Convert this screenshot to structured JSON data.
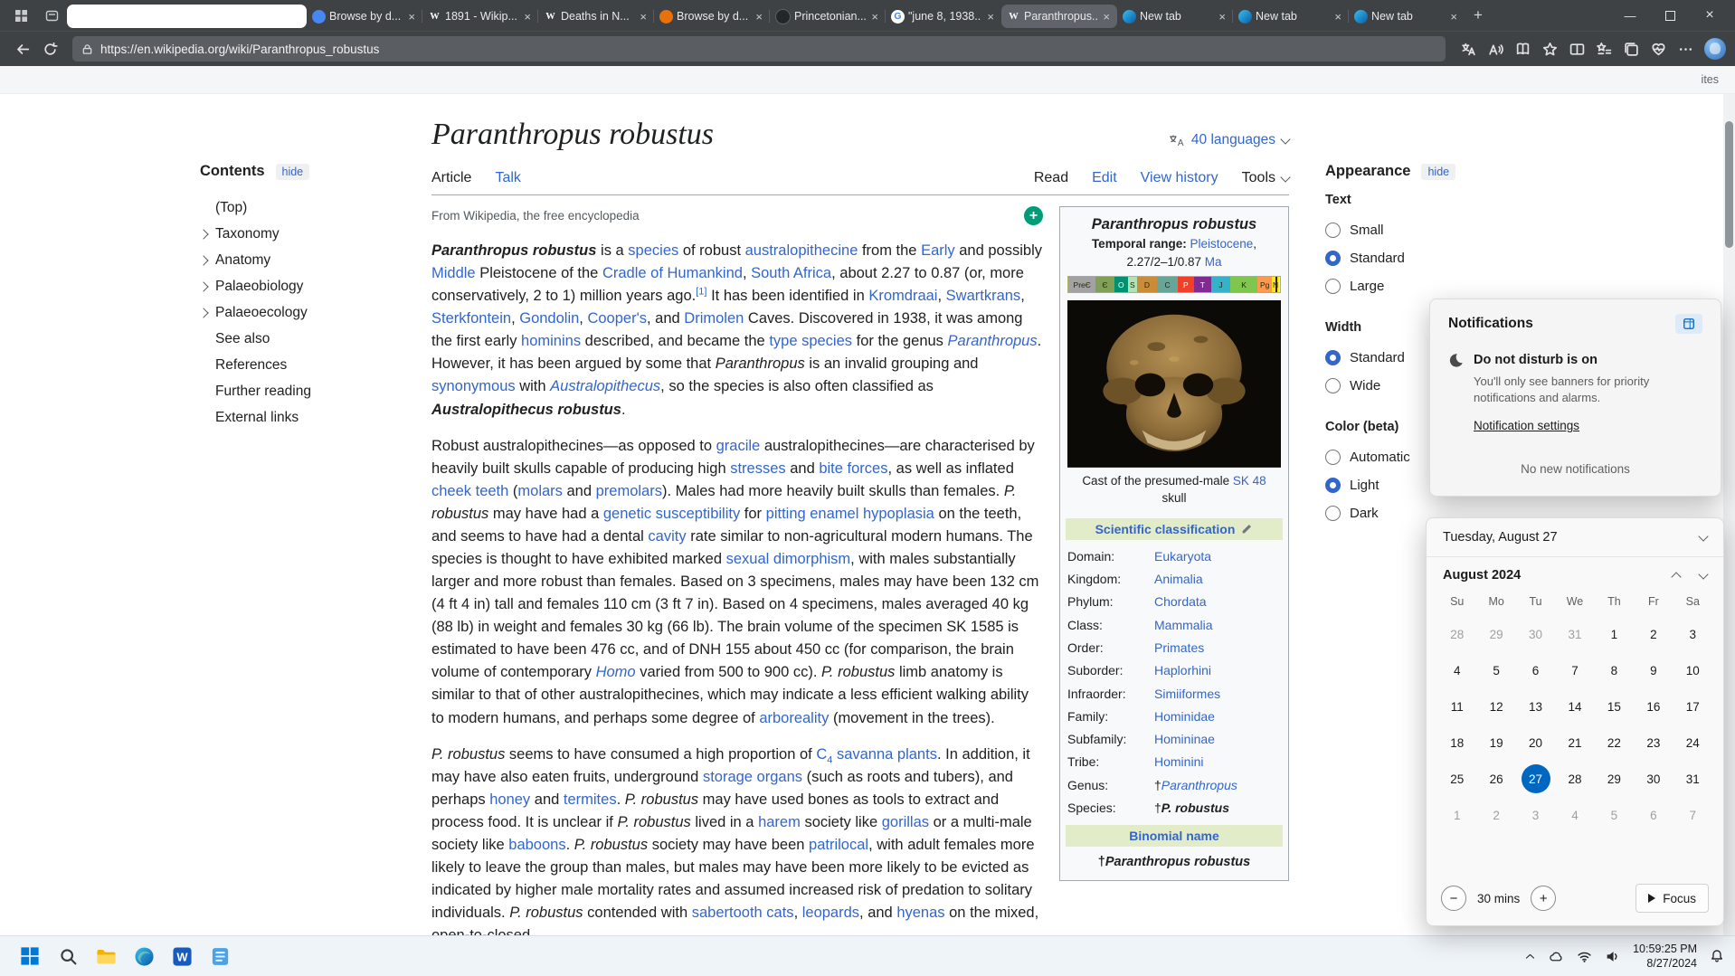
{
  "colors": {
    "accent": "#0067c0",
    "wikilink": "#3366cc",
    "taxobox": "#e3ecc8",
    "accent-wiki": "#3366cc"
  },
  "browser": {
    "tabs": [
      {
        "blank": true
      },
      {
        "label": "Browse by d...",
        "favicon": "globe-blue"
      },
      {
        "label": "1891 - Wikip...",
        "favicon": "wikipedia"
      },
      {
        "label": "Deaths in N...",
        "favicon": "wikipedia"
      },
      {
        "label": "Browse by d...",
        "favicon": "globe-orange"
      },
      {
        "label": "Princetonian...",
        "favicon": "dark"
      },
      {
        "label": "\"june 8, 1938...",
        "favicon": "google"
      },
      {
        "label": "Paranthropus...",
        "favicon": "wikipedia",
        "active": true
      },
      {
        "label": "New tab",
        "favicon": "edge"
      },
      {
        "label": "New tab",
        "favicon": "edge"
      },
      {
        "label": "New tab",
        "favicon": "edge"
      }
    ],
    "url": "https://en.wikipedia.org/wiki/Paranthropus_robustus",
    "favbar_right": "ites"
  },
  "wiki": {
    "title": "Paranthropus robustus",
    "languages": "40 languages",
    "subtitle": "From Wikipedia, the free encyclopedia",
    "page_tabs": [
      {
        "label": "Article",
        "dark": true
      },
      {
        "label": "Talk"
      }
    ],
    "view_tabs": [
      {
        "label": "Read",
        "dark": true
      },
      {
        "label": "Edit"
      },
      {
        "label": "View history"
      },
      {
        "label": "Tools",
        "dark": true,
        "chev": true
      }
    ],
    "toc": {
      "title": "Contents",
      "hide": "hide",
      "items": [
        {
          "label": "(Top)",
          "chev": false
        },
        {
          "label": "Taxonomy",
          "chev": true
        },
        {
          "label": "Anatomy",
          "chev": true
        },
        {
          "label": "Palaeobiology",
          "chev": true
        },
        {
          "label": "Palaeoecology",
          "chev": true
        },
        {
          "label": "See also",
          "chev": false
        },
        {
          "label": "References",
          "chev": false
        },
        {
          "label": "Further reading",
          "chev": false
        },
        {
          "label": "External links",
          "chev": false
        }
      ]
    },
    "paragraphs": [
      [
        {
          "t": "Paranthropus robustus",
          "b": 1,
          "i": 1
        },
        {
          "t": " is a "
        },
        {
          "t": "species",
          "link": 1
        },
        {
          "t": " of robust "
        },
        {
          "t": "australopithecine",
          "link": 1
        },
        {
          "t": " from the "
        },
        {
          "t": "Early",
          "link": 1
        },
        {
          "t": " and possibly "
        },
        {
          "t": "Middle",
          "link": 1
        },
        {
          "t": " Pleistocene of the "
        },
        {
          "t": "Cradle of Humankind",
          "link": 1
        },
        {
          "t": ", "
        },
        {
          "t": "South Africa",
          "link": 1
        },
        {
          "t": ", about 2.27 to 0.87 (or, more conservatively, 2 to 1) million years ago."
        },
        {
          "t": "[1]",
          "link": 1,
          "sup": 1
        },
        {
          "t": " It has been identified in "
        },
        {
          "t": "Kromdraai",
          "link": 1
        },
        {
          "t": ", "
        },
        {
          "t": "Swartkrans",
          "link": 1
        },
        {
          "t": ", "
        },
        {
          "t": "Sterkfontein",
          "link": 1
        },
        {
          "t": ", "
        },
        {
          "t": "Gondolin",
          "link": 1
        },
        {
          "t": ", "
        },
        {
          "t": "Cooper's",
          "link": 1
        },
        {
          "t": ", and "
        },
        {
          "t": "Drimolen",
          "link": 1
        },
        {
          "t": " Caves. Discovered in 1938, it was among the first early "
        },
        {
          "t": "hominins",
          "link": 1
        },
        {
          "t": " described, and became the "
        },
        {
          "t": "type species",
          "link": 1
        },
        {
          "t": " for the genus "
        },
        {
          "t": "Paranthropus",
          "link": 1,
          "i": 1
        },
        {
          "t": ". However, it has been argued by some that "
        },
        {
          "t": "Paranthropus",
          "i": 1
        },
        {
          "t": " is an invalid grouping and "
        },
        {
          "t": "synonymous",
          "link": 1
        },
        {
          "t": " with "
        },
        {
          "t": "Australopithecus",
          "link": 1,
          "i": 1
        },
        {
          "t": ", so the species is also often classified as "
        },
        {
          "t": "Australopithecus robustus",
          "b": 1,
          "i": 1
        },
        {
          "t": "."
        }
      ],
      [
        {
          "t": "Robust australopithecines—as opposed to "
        },
        {
          "t": "gracile",
          "link": 1
        },
        {
          "t": " australopithecines—are characterised by heavily built skulls capable of producing high "
        },
        {
          "t": "stresses",
          "link": 1
        },
        {
          "t": " and "
        },
        {
          "t": "bite forces",
          "link": 1
        },
        {
          "t": ", as well as inflated "
        },
        {
          "t": "cheek teeth",
          "link": 1
        },
        {
          "t": " ("
        },
        {
          "t": "molars",
          "link": 1
        },
        {
          "t": " and "
        },
        {
          "t": "premolars",
          "link": 1
        },
        {
          "t": "). Males had more heavily built skulls than females. "
        },
        {
          "t": "P. robustus",
          "i": 1
        },
        {
          "t": " may have had a "
        },
        {
          "t": "genetic susceptibility",
          "link": 1
        },
        {
          "t": " for "
        },
        {
          "t": "pitting enamel hypoplasia",
          "link": 1
        },
        {
          "t": " on the teeth, and seems to have had a dental "
        },
        {
          "t": "cavity",
          "link": 1
        },
        {
          "t": " rate similar to non-agricultural modern humans. The species is thought to have exhibited marked "
        },
        {
          "t": "sexual dimorphism",
          "link": 1
        },
        {
          "t": ", with males substantially larger and more robust than females. Based on 3 specimens, males may have been 132 cm (4 ft 4 in) tall and females 110 cm (3 ft 7 in). Based on 4 specimens, males averaged 40 kg (88 lb) in weight and females 30 kg (66 lb). The brain volume of the specimen SK 1585 is estimated to have been 476 cc, and of DNH 155 about 450 cc (for comparison, the brain volume of contemporary "
        },
        {
          "t": "Homo",
          "link": 1,
          "i": 1
        },
        {
          "t": " varied from 500 to 900 cc). "
        },
        {
          "t": "P. robustus",
          "i": 1
        },
        {
          "t": " limb anatomy is similar to that of other australopithecines, which may indicate a less efficient walking ability to modern humans, and perhaps some degree of "
        },
        {
          "t": "arboreality",
          "link": 1
        },
        {
          "t": " (movement in the trees)."
        }
      ],
      [
        {
          "t": "P. robustus",
          "i": 1
        },
        {
          "t": " seems to have consumed a high proportion of "
        },
        {
          "t": "C",
          "link": 1
        },
        {
          "t": "4",
          "link": 1,
          "sub": 1
        },
        {
          "t": " savanna plants",
          "link": 1
        },
        {
          "t": ". In addition, it may have also eaten fruits, underground "
        },
        {
          "t": "storage organs",
          "link": 1
        },
        {
          "t": " (such as roots and tubers), and perhaps "
        },
        {
          "t": "honey",
          "link": 1
        },
        {
          "t": " and "
        },
        {
          "t": "termites",
          "link": 1
        },
        {
          "t": ". "
        },
        {
          "t": "P. robustus",
          "i": 1
        },
        {
          "t": " may have used bones as tools to extract and process food. It is unclear if "
        },
        {
          "t": "P. robustus",
          "i": 1
        },
        {
          "t": " lived in a "
        },
        {
          "t": "harem",
          "link": 1
        },
        {
          "t": " society like "
        },
        {
          "t": "gorillas",
          "link": 1
        },
        {
          "t": " or a multi-male society like "
        },
        {
          "t": "baboons",
          "link": 1
        },
        {
          "t": ". "
        },
        {
          "t": "P. robustus",
          "i": 1
        },
        {
          "t": " society may have been "
        },
        {
          "t": "patrilocal",
          "link": 1
        },
        {
          "t": ", with adult females more likely to leave the group than males, but males may have been more likely to be evicted as indicated by higher male mortality rates and assumed increased risk of predation to solitary individuals. "
        },
        {
          "t": "P. robustus",
          "i": 1
        },
        {
          "t": " contended with "
        },
        {
          "t": "sabertooth cats",
          "link": 1
        },
        {
          "t": ", "
        },
        {
          "t": "leopards",
          "link": 1
        },
        {
          "t": ", and "
        },
        {
          "t": "hyenas",
          "link": 1
        },
        {
          "t": "​ on the mixed, open-to-closed "
        }
      ]
    ],
    "infobox": {
      "title": "Paranthropus robustus",
      "temporal_label": "Temporal range:",
      "temporal_link": "Pleistocene",
      "temporal_range": "2.27/2–1/0.87",
      "temporal_unit": "Ma",
      "timeline": [
        {
          "label": "PreЄ",
          "color": "#a2a2a2",
          "w": 13
        },
        {
          "label": "Є",
          "color": "#7FA056",
          "w": 8.6
        },
        {
          "label": "O",
          "color": "#009270",
          "w": 6.7,
          "lt": 1
        },
        {
          "label": "S",
          "color": "#B3E1B6",
          "w": 4
        },
        {
          "label": "D",
          "color": "#CB8C37",
          "w": 9.7
        },
        {
          "label": "C",
          "color": "#67A599",
          "w": 9.7
        },
        {
          "label": "P",
          "color": "#F04028",
          "w": 7.6,
          "lt": 1
        },
        {
          "label": "T",
          "color": "#812B92",
          "w": 8.2,
          "lt": 1
        },
        {
          "label": "J",
          "color": "#34B2C9",
          "w": 9.1
        },
        {
          "label": "K",
          "color": "#7FC64E",
          "w": 12.8
        },
        {
          "label": "Pg",
          "color": "#FD9A52",
          "w": 6.9
        },
        {
          "label": "N",
          "color": "#FFE619",
          "w": 3.3
        },
        {
          "label": "",
          "color": "#F9F97F",
          "w": 0.4
        }
      ],
      "caption_pre": "Cast of the presumed-male ",
      "caption_link": "SK 48",
      "caption_post": " skull",
      "classification_header": "Scientific classification",
      "rows": [
        {
          "label": "Domain:",
          "value": "Eukaryota"
        },
        {
          "label": "Kingdom:",
          "value": "Animalia"
        },
        {
          "label": "Phylum:",
          "value": "Chordata"
        },
        {
          "label": "Class:",
          "value": "Mammalia"
        },
        {
          "label": "Order:",
          "value": "Primates"
        },
        {
          "label": "Suborder:",
          "value": "Haplorhini"
        },
        {
          "label": "Infraorder:",
          "value": "Simiiformes"
        },
        {
          "label": "Family:",
          "value": "Hominidae"
        },
        {
          "label": "Subfamily:",
          "value": "Homininae"
        },
        {
          "label": "Tribe:",
          "value": "Hominini"
        },
        {
          "label": "Genus:",
          "value": "Paranthropus",
          "dagger": true,
          "italic": true
        },
        {
          "label": "Species:",
          "value": "P. robustus",
          "dagger": true,
          "italic": true,
          "bold": true,
          "plain": true
        }
      ],
      "binomial_header": "Binomial name",
      "binomial_dagger": "†",
      "binomial": "Paranthropus robustus"
    },
    "appearance": {
      "title": "Appearance",
      "hide": "hide",
      "sections": [
        {
          "label": "Text",
          "options": [
            "Small",
            "Standard",
            "Large"
          ],
          "selected": 1
        },
        {
          "label": "Width",
          "options": [
            "Standard",
            "Wide"
          ],
          "selected": 0
        },
        {
          "label": "Color (beta)",
          "options": [
            "Automatic",
            "Light",
            "Dark"
          ],
          "selected": 1
        }
      ]
    }
  },
  "notifications": {
    "title": "Notifications",
    "dnd_title": "Do not disturb is on",
    "dnd_desc": "You'll only see banners for priority notifications and alarms.",
    "settings_link": "Notification settings",
    "empty": "No new notifications"
  },
  "calendar": {
    "header": "Tuesday, August 27",
    "month": "August 2024",
    "day_headers": [
      "Su",
      "Mo",
      "Tu",
      "We",
      "Th",
      "Fr",
      "Sa"
    ],
    "weeks": [
      [
        {
          "d": 28,
          "out": true
        },
        {
          "d": 29,
          "out": true
        },
        {
          "d": 30,
          "out": true
        },
        {
          "d": 31,
          "out": true
        },
        {
          "d": 1
        },
        {
          "d": 2
        },
        {
          "d": 3
        }
      ],
      [
        {
          "d": 4
        },
        {
          "d": 5
        },
        {
          "d": 6
        },
        {
          "d": 7
        },
        {
          "d": 8
        },
        {
          "d": 9
        },
        {
          "d": 10
        }
      ],
      [
        {
          "d": 11
        },
        {
          "d": 12
        },
        {
          "d": 13
        },
        {
          "d": 14
        },
        {
          "d": 15
        },
        {
          "d": 16
        },
        {
          "d": 17
        }
      ],
      [
        {
          "d": 18
        },
        {
          "d": 19
        },
        {
          "d": 20
        },
        {
          "d": 21
        },
        {
          "d": 22
        },
        {
          "d": 23
        },
        {
          "d": 24
        }
      ],
      [
        {
          "d": 25
        },
        {
          "d": 26
        },
        {
          "d": 27,
          "selected": true
        },
        {
          "d": 28
        },
        {
          "d": 29
        },
        {
          "d": 30
        },
        {
          "d": 31
        }
      ],
      [
        {
          "d": 1,
          "out": true
        },
        {
          "d": 2,
          "out": true
        },
        {
          "d": 3,
          "out": true
        },
        {
          "d": 4,
          "out": true
        },
        {
          "d": 5,
          "out": true
        },
        {
          "d": 6,
          "out": true
        },
        {
          "d": 7,
          "out": true
        }
      ]
    ],
    "focus_minutes": "30 mins",
    "focus_label": "Focus"
  },
  "taskbar": {
    "time": "10:59:25 PM",
    "date": "8/27/2024"
  }
}
